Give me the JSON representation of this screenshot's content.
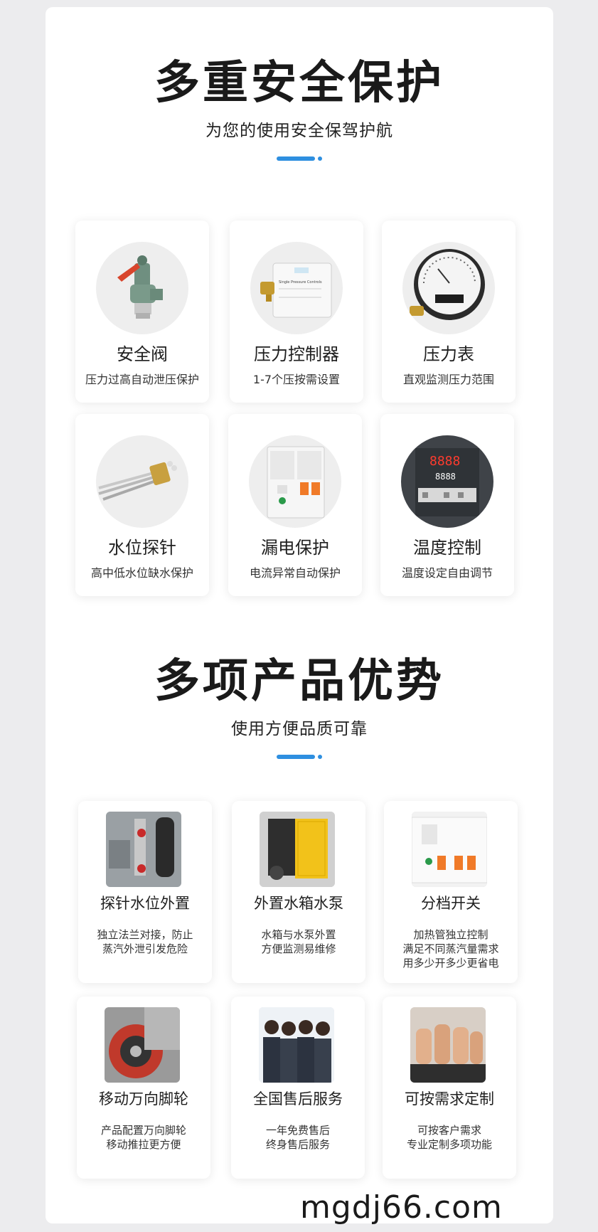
{
  "section1": {
    "title": "多重安全保护",
    "subtitle": "为您的使用安全保驾护航",
    "cards": [
      {
        "title": "安全阀",
        "subtitle": "压力过高自动泄压保护",
        "icon": "safety-valve-icon"
      },
      {
        "title": "压力控制器",
        "subtitle": "1-7个压按需设置",
        "icon": "pressure-controller-icon"
      },
      {
        "title": "压力表",
        "subtitle": "直观监测压力范围",
        "icon": "pressure-gauge-icon"
      },
      {
        "title": "水位探针",
        "subtitle": "高中低水位缺水保护",
        "icon": "water-level-probe-icon"
      },
      {
        "title": "漏电保护",
        "subtitle": "电流异常自动保护",
        "icon": "leakage-breaker-icon"
      },
      {
        "title": "温度控制",
        "subtitle": "温度设定自由调节",
        "icon": "temperature-controller-icon"
      }
    ],
    "controller_label": "Single Pressure Controls",
    "temp_display": "8888"
  },
  "section2": {
    "title": "多项产品优势",
    "subtitle": "使用方便品质可靠",
    "cards": [
      {
        "title": "探针水位外置",
        "desc": "独立法兰对接，防止\n蒸汽外泄引发危险",
        "icon": "external-probe-photo"
      },
      {
        "title": "外置水箱水泵",
        "desc": "水箱与水泵外置\n方便监测易维修",
        "icon": "external-tank-pump-photo"
      },
      {
        "title": "分档开关",
        "desc": "加热管独立控制\n满足不同蒸汽量需求\n用多少开多少更省电",
        "icon": "breaker-switch-photo"
      },
      {
        "title": "移动万向脚轮",
        "desc": "产品配置万向脚轮\n移动推拉更方便",
        "icon": "caster-wheel-photo"
      },
      {
        "title": "全国售后服务",
        "desc": "一年免费售后\n终身售后服务",
        "icon": "service-team-photo"
      },
      {
        "title": "可按需求定制",
        "desc": "可按客户需求\n专业定制多项功能",
        "icon": "thumbs-up-photo"
      }
    ]
  },
  "footer": {
    "url": "mgdj66.com"
  },
  "colors": {
    "accent": "#2e8fe0",
    "background": "#ececee",
    "panel": "#ffffff"
  }
}
